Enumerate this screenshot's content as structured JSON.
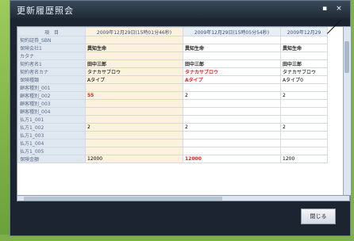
{
  "window": {
    "title": "更新履歴照会",
    "min_label": "▪",
    "close_label": "×"
  },
  "columns": {
    "item": "項　目",
    "col1": "2009年12月29日(15時01分46秒)",
    "col2": "2009年12月29日(15時05分54秒)",
    "col3": "2009年12月29"
  },
  "rows": [
    {
      "label": "契約証券_SBN",
      "c1": "",
      "c2": "",
      "c3": ""
    },
    {
      "label": "保険会社1",
      "c1": "異知生命",
      "c2": "異知生命",
      "c3": "異知生命"
    },
    {
      "label": "カタナ",
      "c1": "",
      "c2": "",
      "c3": ""
    },
    {
      "label": "契約者名1",
      "c1": "田中三郎",
      "c2": "田中三郎",
      "c3": "田中三郎"
    },
    {
      "label": "契約者名カナ",
      "c1": "タナカサブロウ",
      "c2": "タナカサブロウ",
      "c3": "タナカサブロウ"
    },
    {
      "label": "保険種類",
      "c1": "Aタイプ",
      "c2": "Aタイプ",
      "c3": "Aタイプ0"
    },
    {
      "label": "顧客種別_001",
      "c1": "",
      "c2": "",
      "c3": ""
    },
    {
      "label": "顧客種別_002",
      "c1": "55",
      "c2": "2",
      "c3": "2"
    },
    {
      "label": "顧客種別_003",
      "c1": "",
      "c2": "",
      "c3": ""
    },
    {
      "label": "顧客種別_004",
      "c1": "",
      "c2": "",
      "c3": ""
    },
    {
      "label": "払方1_001",
      "c1": "",
      "c2": "",
      "c3": ""
    },
    {
      "label": "払方1_002",
      "c1": "2",
      "c2": "2",
      "c3": "2"
    },
    {
      "label": "払方1_003",
      "c1": "",
      "c2": "",
      "c3": ""
    },
    {
      "label": "払方1_004",
      "c1": "",
      "c2": "",
      "c3": ""
    },
    {
      "label": "払方1_005",
      "c1": "",
      "c2": "",
      "c3": ""
    },
    {
      "label": "保険金額",
      "c1": "12000",
      "c2": "12000",
      "c3": "1200"
    }
  ],
  "highlight": {
    "red_rows": [
      7
    ],
    "red_col2_rows": [
      4,
      5,
      15
    ]
  },
  "footer": {
    "close_label": "閉じる"
  },
  "colors": {
    "window_bg": "#1b2430",
    "accent_red": "#e02222",
    "label_bg": "#dfe7f1",
    "col1_bg": "#fbf1dc"
  }
}
